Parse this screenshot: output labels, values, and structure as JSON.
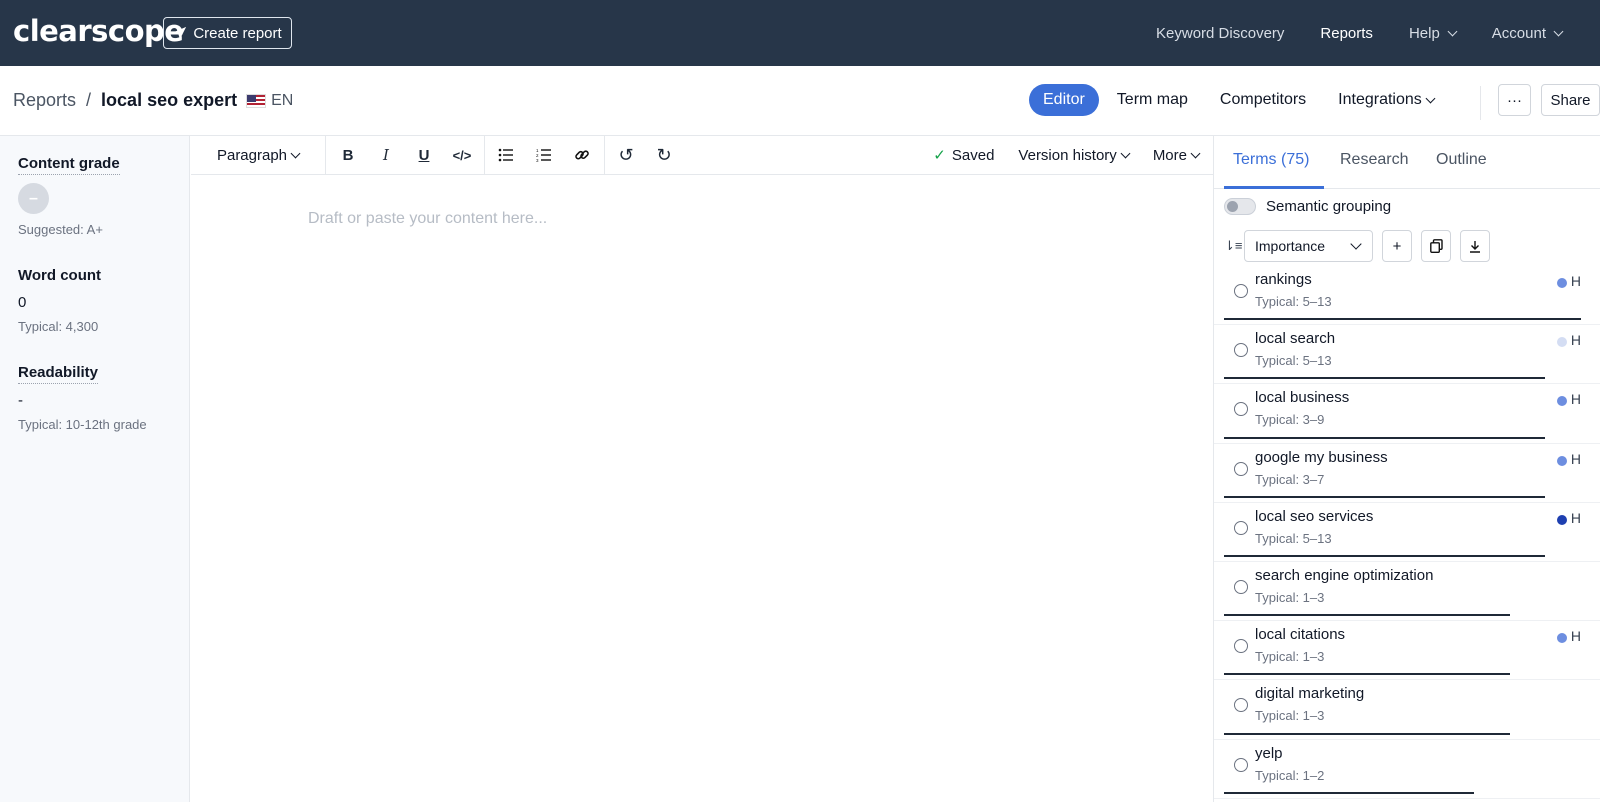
{
  "topnav": {
    "logo": "clearscope",
    "create_report": "Create report",
    "links": [
      "Keyword Discovery",
      "Reports",
      "Help",
      "Account"
    ]
  },
  "subheader": {
    "breadcrumb_root": "Reports",
    "breadcrumb_sep": "/",
    "report_title": "local seo expert",
    "language": "EN",
    "view_tabs": [
      "Editor",
      "Term map",
      "Competitors",
      "Integrations"
    ],
    "more_label": "···",
    "share_label": "Share"
  },
  "left": {
    "content_grade_label": "Content grade",
    "content_grade_value": "–",
    "suggested": "Suggested: A+",
    "word_count_label": "Word count",
    "word_count_value": "0",
    "word_count_typical": "Typical: 4,300",
    "readability_label": "Readability",
    "readability_value": "-",
    "readability_typical": "Typical: 10-12th grade"
  },
  "toolbar": {
    "paragraph": "Paragraph",
    "saved": "Saved",
    "version_history": "Version history",
    "more": "More"
  },
  "editor": {
    "placeholder": "Draft or paste your content here..."
  },
  "right": {
    "tabs": [
      "Terms (75)",
      "Research",
      "Outline"
    ],
    "semantic_grouping": "Semantic grouping",
    "sort_select": "Importance",
    "terms": [
      {
        "name": "rankings",
        "typical": "Typical: 5–13",
        "heading": "H",
        "dot": "#6d8ee0",
        "progress": 1.0
      },
      {
        "name": "local search",
        "typical": "Typical: 5–13",
        "heading": "H",
        "dot": "#d4ddf3",
        "progress": 0.9
      },
      {
        "name": "local business",
        "typical": "Typical: 3–9",
        "heading": "H",
        "dot": "#6d8ee0",
        "progress": 0.9
      },
      {
        "name": "google my business",
        "typical": "Typical: 3–7",
        "heading": "H",
        "dot": "#6d8ee0",
        "progress": 0.9
      },
      {
        "name": "local seo services",
        "typical": "Typical: 5–13",
        "heading": "H",
        "dot": "#1e3fb0",
        "progress": 0.9
      },
      {
        "name": "search engine optimization",
        "typical": "Typical: 1–3",
        "heading": "",
        "dot": "",
        "progress": 0.8
      },
      {
        "name": "local citations",
        "typical": "Typical: 1–3",
        "heading": "H",
        "dot": "#6d8ee0",
        "progress": 0.8
      },
      {
        "name": "digital marketing",
        "typical": "Typical: 1–3",
        "heading": "",
        "dot": "",
        "progress": 0.8
      },
      {
        "name": "yelp",
        "typical": "Typical: 1–2",
        "heading": "",
        "dot": "",
        "progress": 0.7
      }
    ]
  }
}
